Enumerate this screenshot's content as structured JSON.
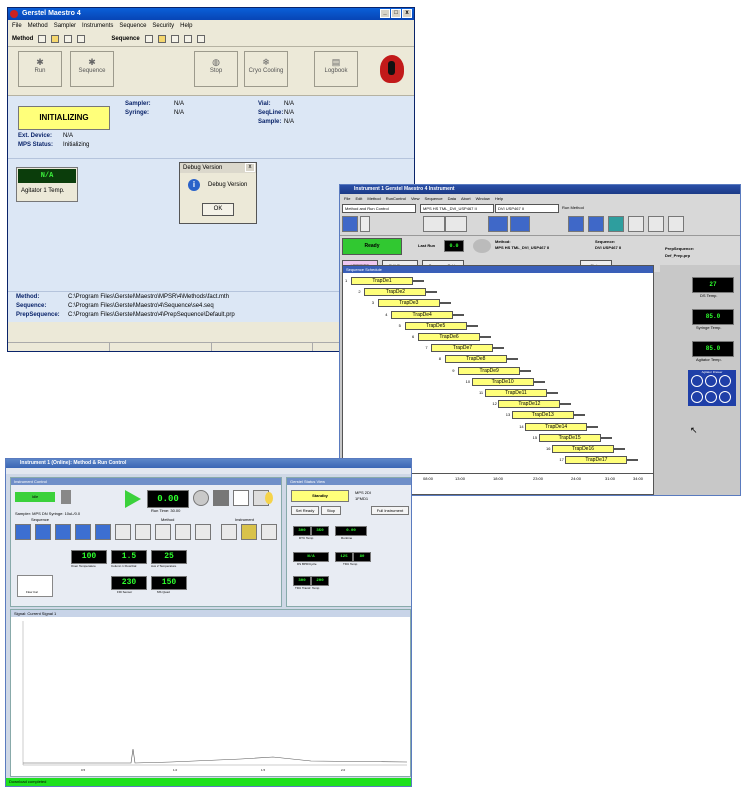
{
  "w1": {
    "title": "Gerstel Maestro 4",
    "menu": [
      "File",
      "Method",
      "Sampler",
      "Instruments",
      "Sequence",
      "Security",
      "Help"
    ],
    "toolbar_method": "Method",
    "toolbar_sequence": "Sequence",
    "buttons": [
      "Run",
      "Sequence",
      "Stop",
      "Cryo Cooling",
      "Logbook"
    ],
    "status": "INITIALIZING",
    "sampler_label": "Sampler:",
    "sampler_val": "N/A",
    "syringe_label": "Syringe:",
    "syringe_val": "N/A",
    "vial_label": "Vial:",
    "vial_val": "N/A",
    "seqline_label": "SeqLine:",
    "seqline_val": "N/A",
    "sample_label": "Sample:",
    "sample_val": "N/A",
    "extdev_label": "Ext. Device:",
    "extdev_val": "N/A",
    "mps_label": "MPS Status:",
    "mps_val": "Initializing",
    "agitator_val": "N/A",
    "agitator_label": "Agitator 1 Temp.",
    "dialog_title": "Debug Version",
    "dialog_msg": "Debug Version",
    "dialog_ok": "OK",
    "method_label": "Method:",
    "method_path": "C:\\Program Files\\Gerstel\\Maestro\\MPSR\\4\\Methods\\fact.mth",
    "sequence_label": "Sequence:",
    "sequence_path": "C:\\Program Files\\Gerstel\\Maestro\\4\\Sequence\\se4.seq",
    "prepseq_label": "PrepSequence:",
    "prepseq_path": "C:\\Program Files\\Gerstel\\Maestro\\4\\PrepSequence\\Default.prp"
  },
  "w2": {
    "title": "Instrument 1 Gerstel Maestro 4 Instrument",
    "menu": [
      "File",
      "Edit",
      "Method",
      "RunControl",
      "View",
      "Sequence",
      "Data",
      "Abort",
      "Window",
      "Help"
    ],
    "method_dropdown": "Method and Run Control",
    "method_file": "MPS HS TML_DVI_USP467 II",
    "seq_file": "DVI USP467 II",
    "run_method": "Run Method",
    "status": "Ready",
    "last_run_label": "Last Run",
    "last_run_val": "0.0",
    "method_label": "Method:",
    "method_name": "MPS HS TML_DVI_USP467 II",
    "sequence_label": "Sequence:",
    "sequence_name": "DVI USP467 II",
    "prepseq_label": "PrepSequence:",
    "prepseq_name": "Def_Prep.prp",
    "btn_verified": "VERIFIED",
    "btn_edit": "Edit Params",
    "btn_seqtable": "Sequence Table",
    "btn_status": "Status",
    "schedule_title": "Sequence Schedule",
    "bars": [
      "TrapDe1",
      "TrapDe2",
      "TrapDe3",
      "TrapDe4",
      "TrapDe5",
      "TrapDe6",
      "TrapDe7",
      "TrapDe8",
      "TrapDe9",
      "TrapDe10",
      "TrapDe11",
      "TrapDe12",
      "TrapDe13",
      "TrapDe14",
      "TrapDe15",
      "TrapDe16",
      "TrapDe17"
    ],
    "time_labels": [
      "08:00",
      "13:00",
      "18:00",
      "23:00",
      "24:00",
      "31:00",
      "34:00"
    ],
    "duration": "Duration: 0:43:00",
    "t1_val": "27",
    "t1_label": "DS Temp.",
    "t2_val": "85.0",
    "t2_label": "Syringe Temp.",
    "t3_val": "85.0",
    "t3_label": "Agitator Temp.",
    "agitator_title": "Agitator Drawer"
  },
  "w3": {
    "title": "Instrument 1 (Online): Method & Run Control",
    "ic_title": "Instrument Control",
    "ready": "Idle",
    "big_val": "0.00",
    "run_time": "Run Time: 30.00",
    "sampler_line": "Sampler: MPS DN   Syringe: 10uL/0.0",
    "sequence_label": "Sequence",
    "method_label": "Method",
    "instrument_label": "Instrument",
    "v1": "100",
    "v1_label": "Oven Temperature",
    "v2": "1.5",
    "v2_label": "Column 1 Flow/Cal",
    "v3": "25",
    "v3_label": "Aux 2 Temperature",
    "v4": "230",
    "v4_label": "FID Sensor",
    "v5": "150",
    "v5_label": "MS Quad",
    "hold_label": "Flow Cal",
    "gs_title": "Gerstel Status View",
    "gs_status": "Standby",
    "gs_sampler": "MPS 2DI",
    "gs_syringe": "1FMD1",
    "gs_btn1": "Set Ready",
    "gs_btn2": "Stop",
    "gs_btn3": "Full Instrument",
    "g1a": "300",
    "g1b": "350",
    "g1_label": "DTC Temp",
    "g2": "0.00",
    "g2_label": "Runtime",
    "g3": "N/A",
    "g3_label": "DS BPD/Cycle",
    "g4a": "125",
    "g4b": "80",
    "g4_label": "TDU Temp",
    "g5a": "300",
    "g5b": "200",
    "g5_label": "TDU Transf. Temp",
    "signal_title": "Signal: Current Signal 1",
    "axis_labels": [
      "0.5",
      "1.0",
      "1.5",
      "2.0"
    ],
    "status_bar": "Download completed"
  }
}
